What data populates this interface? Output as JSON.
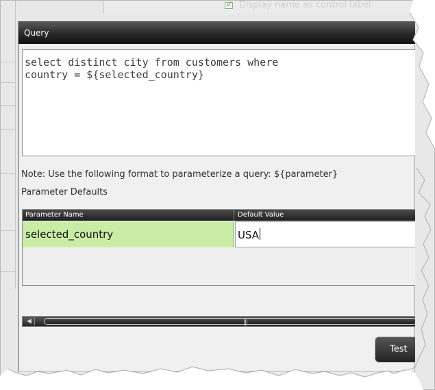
{
  "background": {
    "display_name_label": "Display name as control label"
  },
  "modal": {
    "title": "Query",
    "query_text": "select distinct city from customers where\ncountry = ${selected_country}",
    "note_text": "Note: Use the following format to parameterize a query: ${parameter}",
    "section_label": "Parameter Defaults"
  },
  "table": {
    "columns": {
      "parameter_name": "Parameter Name",
      "default_value": "Default Value"
    },
    "rows": [
      {
        "parameter_name": "selected_country",
        "default_value": "USA"
      }
    ]
  },
  "buttons": {
    "test_label": "Test"
  },
  "icons": {
    "check": "check-icon",
    "scroll_left": "chevron-left-icon"
  },
  "colors": {
    "header_dark": "#1b1b1b",
    "highlight_green": "#c9eda5",
    "panel_gray": "#f0f0f0"
  }
}
